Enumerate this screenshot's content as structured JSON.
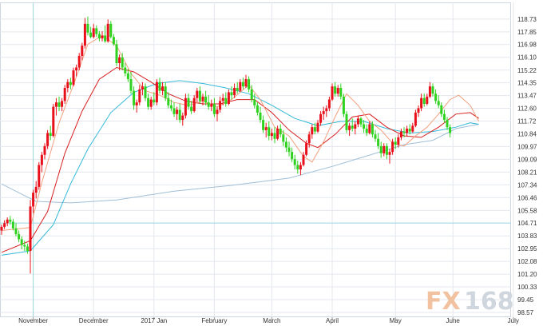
{
  "watermark": {
    "fx": "FX",
    "num": "168"
  },
  "chart_data": {
    "type": "candlestick",
    "instrument": "",
    "ylim": [
      98.57,
      119.6
    ],
    "y_ticks": [
      "118.73",
      "117.85",
      "116.98",
      "116.10",
      "115.22",
      "114.35",
      "113.47",
      "112.60",
      "111.72",
      "110.84",
      "109.97",
      "109.09",
      "108.21",
      "107.34",
      "106.46",
      "105.58",
      "104.71",
      "103.83",
      "102.95",
      "102.08",
      "101.20",
      "100.33",
      "99.45",
      "98.57"
    ],
    "x_labels": [
      {
        "label": "November",
        "day": 11
      },
      {
        "label": "December",
        "day": 32
      },
      {
        "label": "2017 Jan",
        "day": 53
      },
      {
        "label": "February",
        "day": 74
      },
      {
        "label": "March",
        "day": 94
      },
      {
        "label": "April",
        "day": 115
      },
      {
        "label": "May",
        "day": 137
      },
      {
        "label": "June",
        "day": 157
      },
      {
        "label": "July",
        "day": 178
      }
    ],
    "reference_lines": {
      "vertical_day": 11,
      "horizontal_price": 104.71
    },
    "colors": {
      "up": "#e8101a",
      "down": "#2fd31f",
      "ma_fast": "#f3a07e",
      "ma_mid": "#d81e1e",
      "ma_slow": "#35b9d9",
      "ma_long": "#9fbfd7",
      "grid": "#e3e7ed",
      "guide": "#9fd8e2"
    },
    "ohlc": [
      [
        104.2,
        104.6,
        103.9,
        104.45
      ],
      [
        104.45,
        104.9,
        104.3,
        104.7
      ],
      [
        104.7,
        105.1,
        104.5,
        104.95
      ],
      [
        104.95,
        105.2,
        104.6,
        104.8
      ],
      [
        104.8,
        105.0,
        104.2,
        104.35
      ],
      [
        104.35,
        104.7,
        103.8,
        103.95
      ],
      [
        103.95,
        104.2,
        103.4,
        103.6
      ],
      [
        103.6,
        103.8,
        102.9,
        103.2
      ],
      [
        103.2,
        103.5,
        102.8,
        103.1
      ],
      [
        103.1,
        103.3,
        102.6,
        102.8
      ],
      [
        102.8,
        106.3,
        101.25,
        105.85
      ],
      [
        105.85,
        107.0,
        105.4,
        106.8
      ],
      [
        106.8,
        107.6,
        106.4,
        107.2
      ],
      [
        107.2,
        108.9,
        107.0,
        108.7
      ],
      [
        108.7,
        109.6,
        108.2,
        109.4
      ],
      [
        109.4,
        110.2,
        109.1,
        110.0
      ],
      [
        110.0,
        111.1,
        109.8,
        110.9
      ],
      [
        110.9,
        111.4,
        110.4,
        110.7
      ],
      [
        110.7,
        112.9,
        110.6,
        112.7
      ],
      [
        112.7,
        113.3,
        112.1,
        113.0
      ],
      [
        113.0,
        113.4,
        112.4,
        112.7
      ],
      [
        112.7,
        113.3,
        112.4,
        113.1
      ],
      [
        113.1,
        114.2,
        112.9,
        114.0
      ],
      [
        114.0,
        114.6,
        113.7,
        114.4
      ],
      [
        114.4,
        114.7,
        113.9,
        114.2
      ],
      [
        114.2,
        115.4,
        114.1,
        115.2
      ],
      [
        115.2,
        115.6,
        114.8,
        115.4
      ],
      [
        115.4,
        116.4,
        115.2,
        116.2
      ],
      [
        116.2,
        117.1,
        115.9,
        116.9
      ],
      [
        116.9,
        118.8,
        116.7,
        118.4
      ],
      [
        118.4,
        118.9,
        117.6,
        117.8
      ],
      [
        117.8,
        118.2,
        117.4,
        117.5
      ],
      [
        117.5,
        118.4,
        117.4,
        118.1
      ],
      [
        118.1,
        118.3,
        117.5,
        117.7
      ],
      [
        117.7,
        117.9,
        117.2,
        117.4
      ],
      [
        117.4,
        117.9,
        117.2,
        117.6
      ],
      [
        117.6,
        118.3,
        117.1,
        117.2
      ],
      [
        117.2,
        118.7,
        117.1,
        118.4
      ],
      [
        118.4,
        118.6,
        117.4,
        117.5
      ],
      [
        117.5,
        117.7,
        116.9,
        117.0
      ],
      [
        117.0,
        117.3,
        115.5,
        115.7
      ],
      [
        115.7,
        116.3,
        115.2,
        116.1
      ],
      [
        116.1,
        116.4,
        115.2,
        115.4
      ],
      [
        115.4,
        115.7,
        114.8,
        115.0
      ],
      [
        115.0,
        115.3,
        114.4,
        114.6
      ],
      [
        114.6,
        115.1,
        113.6,
        113.8
      ],
      [
        113.8,
        114.1,
        112.5,
        112.8
      ],
      [
        112.8,
        113.2,
        112.3,
        113.0
      ],
      [
        113.0,
        114.2,
        112.8,
        113.9
      ],
      [
        113.9,
        114.4,
        113.5,
        114.1
      ],
      [
        114.1,
        114.3,
        113.1,
        113.3
      ],
      [
        113.3,
        113.6,
        112.5,
        112.7
      ],
      [
        112.7,
        113.4,
        112.5,
        113.2
      ],
      [
        113.2,
        113.7,
        112.8,
        113.0
      ],
      [
        113.0,
        114.6,
        112.8,
        114.4
      ],
      [
        114.4,
        114.7,
        113.6,
        113.8
      ],
      [
        113.8,
        114.4,
        113.5,
        114.1
      ],
      [
        114.1,
        114.4,
        113.1,
        113.3
      ],
      [
        113.3,
        113.7,
        112.6,
        112.8
      ],
      [
        112.8,
        113.2,
        112.4,
        112.6
      ],
      [
        112.6,
        113.0,
        112.0,
        112.2
      ],
      [
        112.2,
        112.7,
        111.8,
        112.5
      ],
      [
        112.5,
        112.9,
        111.6,
        111.8
      ],
      [
        111.8,
        112.3,
        111.4,
        112.1
      ],
      [
        112.1,
        113.6,
        111.9,
        113.3
      ],
      [
        113.3,
        113.6,
        112.5,
        112.7
      ],
      [
        112.7,
        113.1,
        112.2,
        112.4
      ],
      [
        112.4,
        113.5,
        112.3,
        113.3
      ],
      [
        113.3,
        114.0,
        113.0,
        113.8
      ],
      [
        113.8,
        114.1,
        112.9,
        113.1
      ],
      [
        113.1,
        113.6,
        112.8,
        113.4
      ],
      [
        113.4,
        113.8,
        112.8,
        113.0
      ],
      [
        113.0,
        113.5,
        112.5,
        112.7
      ],
      [
        112.7,
        113.2,
        112.4,
        112.9
      ],
      [
        112.9,
        113.3,
        112.0,
        112.2
      ],
      [
        112.2,
        112.7,
        111.7,
        112.5
      ],
      [
        112.5,
        113.4,
        112.3,
        113.1
      ],
      [
        113.1,
        113.6,
        112.8,
        113.3
      ],
      [
        113.3,
        113.7,
        112.7,
        112.9
      ],
      [
        112.9,
        113.9,
        112.8,
        113.7
      ],
      [
        113.7,
        114.1,
        113.2,
        113.5
      ],
      [
        113.5,
        114.3,
        113.3,
        114.0
      ],
      [
        114.0,
        114.4,
        113.6,
        113.8
      ],
      [
        113.8,
        114.6,
        113.7,
        114.4
      ],
      [
        114.4,
        114.7,
        113.9,
        114.1
      ],
      [
        114.1,
        114.9,
        114.0,
        114.6
      ],
      [
        114.6,
        114.8,
        113.7,
        113.9
      ],
      [
        113.9,
        114.2,
        113.0,
        113.2
      ],
      [
        113.2,
        113.6,
        112.6,
        112.8
      ],
      [
        112.8,
        113.0,
        112.1,
        112.3
      ],
      [
        112.3,
        112.7,
        111.6,
        111.8
      ],
      [
        111.8,
        112.1,
        110.9,
        111.1
      ],
      [
        111.1,
        111.6,
        110.6,
        111.3
      ],
      [
        111.3,
        111.7,
        110.4,
        110.7
      ],
      [
        110.7,
        111.2,
        110.4,
        110.9
      ],
      [
        110.9,
        111.3,
        110.2,
        110.5
      ],
      [
        110.5,
        111.4,
        110.4,
        111.2
      ],
      [
        111.2,
        111.5,
        110.6,
        110.8
      ],
      [
        110.8,
        111.1,
        110.0,
        110.3
      ],
      [
        110.3,
        110.6,
        109.6,
        109.9
      ],
      [
        109.9,
        110.3,
        109.3,
        109.6
      ],
      [
        109.6,
        109.9,
        108.9,
        109.1
      ],
      [
        109.1,
        109.4,
        108.4,
        108.7
      ],
      [
        108.7,
        109.0,
        108.1,
        108.4
      ],
      [
        108.4,
        108.9,
        108.0,
        108.7
      ],
      [
        108.7,
        109.6,
        108.6,
        109.4
      ],
      [
        109.4,
        110.4,
        109.3,
        110.2
      ],
      [
        110.2,
        111.0,
        109.9,
        110.8
      ],
      [
        110.8,
        111.5,
        110.5,
        111.3
      ],
      [
        111.3,
        111.6,
        110.8,
        111.0
      ],
      [
        111.0,
        111.8,
        110.9,
        111.6
      ],
      [
        111.6,
        112.4,
        111.4,
        112.2
      ],
      [
        112.2,
        112.7,
        111.8,
        112.4
      ],
      [
        112.4,
        112.8,
        112.0,
        112.6
      ],
      [
        112.6,
        113.4,
        112.4,
        113.2
      ],
      [
        113.2,
        114.3,
        113.1,
        114.1
      ],
      [
        114.1,
        114.4,
        113.4,
        113.6
      ],
      [
        113.6,
        114.2,
        113.4,
        114.0
      ],
      [
        114.0,
        114.3,
        113.2,
        113.4
      ],
      [
        113.4,
        113.6,
        112.0,
        112.2
      ],
      [
        112.2,
        112.4,
        110.9,
        111.1
      ],
      [
        111.1,
        111.6,
        110.7,
        111.4
      ],
      [
        111.4,
        111.9,
        111.0,
        111.2
      ],
      [
        111.2,
        111.7,
        110.8,
        111.5
      ],
      [
        111.5,
        112.1,
        111.3,
        111.9
      ],
      [
        111.9,
        112.0,
        111.3,
        111.5
      ],
      [
        111.5,
        111.8,
        110.9,
        111.2
      ],
      [
        111.2,
        111.5,
        110.7,
        110.9
      ],
      [
        110.9,
        111.7,
        110.8,
        111.5
      ],
      [
        111.5,
        111.7,
        110.6,
        110.8
      ],
      [
        110.8,
        111.1,
        110.3,
        110.5
      ],
      [
        110.5,
        110.9,
        109.8,
        110.0
      ],
      [
        110.0,
        110.3,
        109.2,
        109.5
      ],
      [
        109.5,
        110.2,
        109.3,
        110.0
      ],
      [
        110.0,
        110.2,
        109.1,
        109.4
      ],
      [
        109.4,
        109.8,
        108.8,
        109.6
      ],
      [
        109.6,
        110.5,
        109.4,
        110.3
      ],
      [
        110.3,
        110.6,
        109.8,
        110.1
      ],
      [
        110.1,
        110.8,
        109.9,
        110.6
      ],
      [
        110.6,
        111.2,
        110.4,
        111.0
      ],
      [
        111.0,
        111.3,
        110.6,
        110.9
      ],
      [
        110.9,
        111.4,
        110.7,
        111.2
      ],
      [
        111.2,
        111.5,
        110.8,
        111.0
      ],
      [
        111.0,
        111.6,
        110.9,
        111.4
      ],
      [
        111.4,
        112.5,
        111.3,
        112.3
      ],
      [
        112.3,
        112.8,
        112.0,
        112.6
      ],
      [
        112.6,
        113.6,
        112.4,
        113.3
      ],
      [
        113.3,
        113.6,
        112.7,
        112.9
      ],
      [
        112.9,
        113.6,
        112.8,
        113.4
      ],
      [
        113.4,
        114.4,
        113.3,
        114.1
      ],
      [
        114.1,
        114.3,
        113.4,
        113.6
      ],
      [
        113.6,
        113.9,
        112.9,
        113.1
      ],
      [
        113.1,
        113.5,
        112.6,
        112.8
      ],
      [
        112.8,
        113.0,
        112.0,
        112.2
      ],
      [
        112.2,
        112.5,
        111.6,
        111.8
      ],
      [
        111.8,
        112.0,
        111.1,
        111.3
      ],
      [
        111.3,
        111.5,
        110.6,
        110.9
      ]
    ],
    "ma_fast": [
      [
        0,
        104.2
      ],
      [
        10,
        104.4
      ],
      [
        14,
        107.5
      ],
      [
        20,
        111.6
      ],
      [
        25,
        114.2
      ],
      [
        30,
        117.0
      ],
      [
        35,
        117.6
      ],
      [
        40,
        116.9
      ],
      [
        45,
        115.0
      ],
      [
        50,
        113.8
      ],
      [
        55,
        113.5
      ],
      [
        60,
        113.0
      ],
      [
        65,
        112.8
      ],
      [
        70,
        113.1
      ],
      [
        75,
        112.7
      ],
      [
        80,
        113.2
      ],
      [
        86,
        114.2
      ],
      [
        90,
        113.2
      ],
      [
        95,
        111.3
      ],
      [
        100,
        110.7
      ],
      [
        105,
        109.3
      ],
      [
        108,
        108.9
      ],
      [
        112,
        110.3
      ],
      [
        116,
        112.0
      ],
      [
        120,
        113.6
      ],
      [
        124,
        112.8
      ],
      [
        128,
        111.7
      ],
      [
        132,
        111.1
      ],
      [
        136,
        110.2
      ],
      [
        140,
        110.0
      ],
      [
        144,
        110.7
      ],
      [
        148,
        111.3
      ],
      [
        152,
        112.2
      ],
      [
        156,
        113.2
      ],
      [
        159,
        113.5
      ],
      [
        163,
        112.8
      ],
      [
        166,
        111.7
      ]
    ],
    "ma_mid": [
      [
        0,
        102.7
      ],
      [
        10,
        103.5
      ],
      [
        16,
        105.5
      ],
      [
        22,
        109.5
      ],
      [
        28,
        112.4
      ],
      [
        34,
        114.6
      ],
      [
        40,
        115.4
      ],
      [
        46,
        115.1
      ],
      [
        52,
        114.4
      ],
      [
        58,
        113.6
      ],
      [
        64,
        113.1
      ],
      [
        70,
        112.9
      ],
      [
        76,
        112.9
      ],
      [
        82,
        113.2
      ],
      [
        88,
        113.2
      ],
      [
        94,
        112.3
      ],
      [
        100,
        111.1
      ],
      [
        106,
        110.2
      ],
      [
        110,
        109.9
      ],
      [
        116,
        110.8
      ],
      [
        122,
        112.0
      ],
      [
        128,
        112.2
      ],
      [
        134,
        111.3
      ],
      [
        140,
        110.7
      ],
      [
        146,
        110.6
      ],
      [
        152,
        111.3
      ],
      [
        158,
        112.2
      ],
      [
        163,
        112.3
      ],
      [
        166,
        111.9
      ]
    ],
    "ma_slow": [
      [
        0,
        102.5
      ],
      [
        10,
        102.8
      ],
      [
        18,
        104.6
      ],
      [
        24,
        107.4
      ],
      [
        30,
        109.8
      ],
      [
        38,
        112.3
      ],
      [
        46,
        113.7
      ],
      [
        54,
        114.3
      ],
      [
        62,
        114.5
      ],
      [
        70,
        114.3
      ],
      [
        78,
        114.0
      ],
      [
        86,
        113.6
      ],
      [
        94,
        112.8
      ],
      [
        102,
        111.9
      ],
      [
        110,
        111.4
      ],
      [
        118,
        111.7
      ],
      [
        126,
        111.7
      ],
      [
        134,
        111.2
      ],
      [
        142,
        110.9
      ],
      [
        150,
        111.0
      ],
      [
        158,
        111.3
      ],
      [
        163,
        111.6
      ],
      [
        166,
        111.5
      ]
    ],
    "ma_long": [
      [
        0,
        107.4
      ],
      [
        8,
        106.6
      ],
      [
        12,
        106.2
      ],
      [
        24,
        106.1
      ],
      [
        40,
        106.3
      ],
      [
        60,
        106.9
      ],
      [
        80,
        107.3
      ],
      [
        100,
        107.8
      ],
      [
        115,
        108.6
      ],
      [
        125,
        109.2
      ],
      [
        140,
        110.1
      ],
      [
        150,
        110.4
      ],
      [
        158,
        111.2
      ],
      [
        166,
        111.5
      ]
    ]
  }
}
